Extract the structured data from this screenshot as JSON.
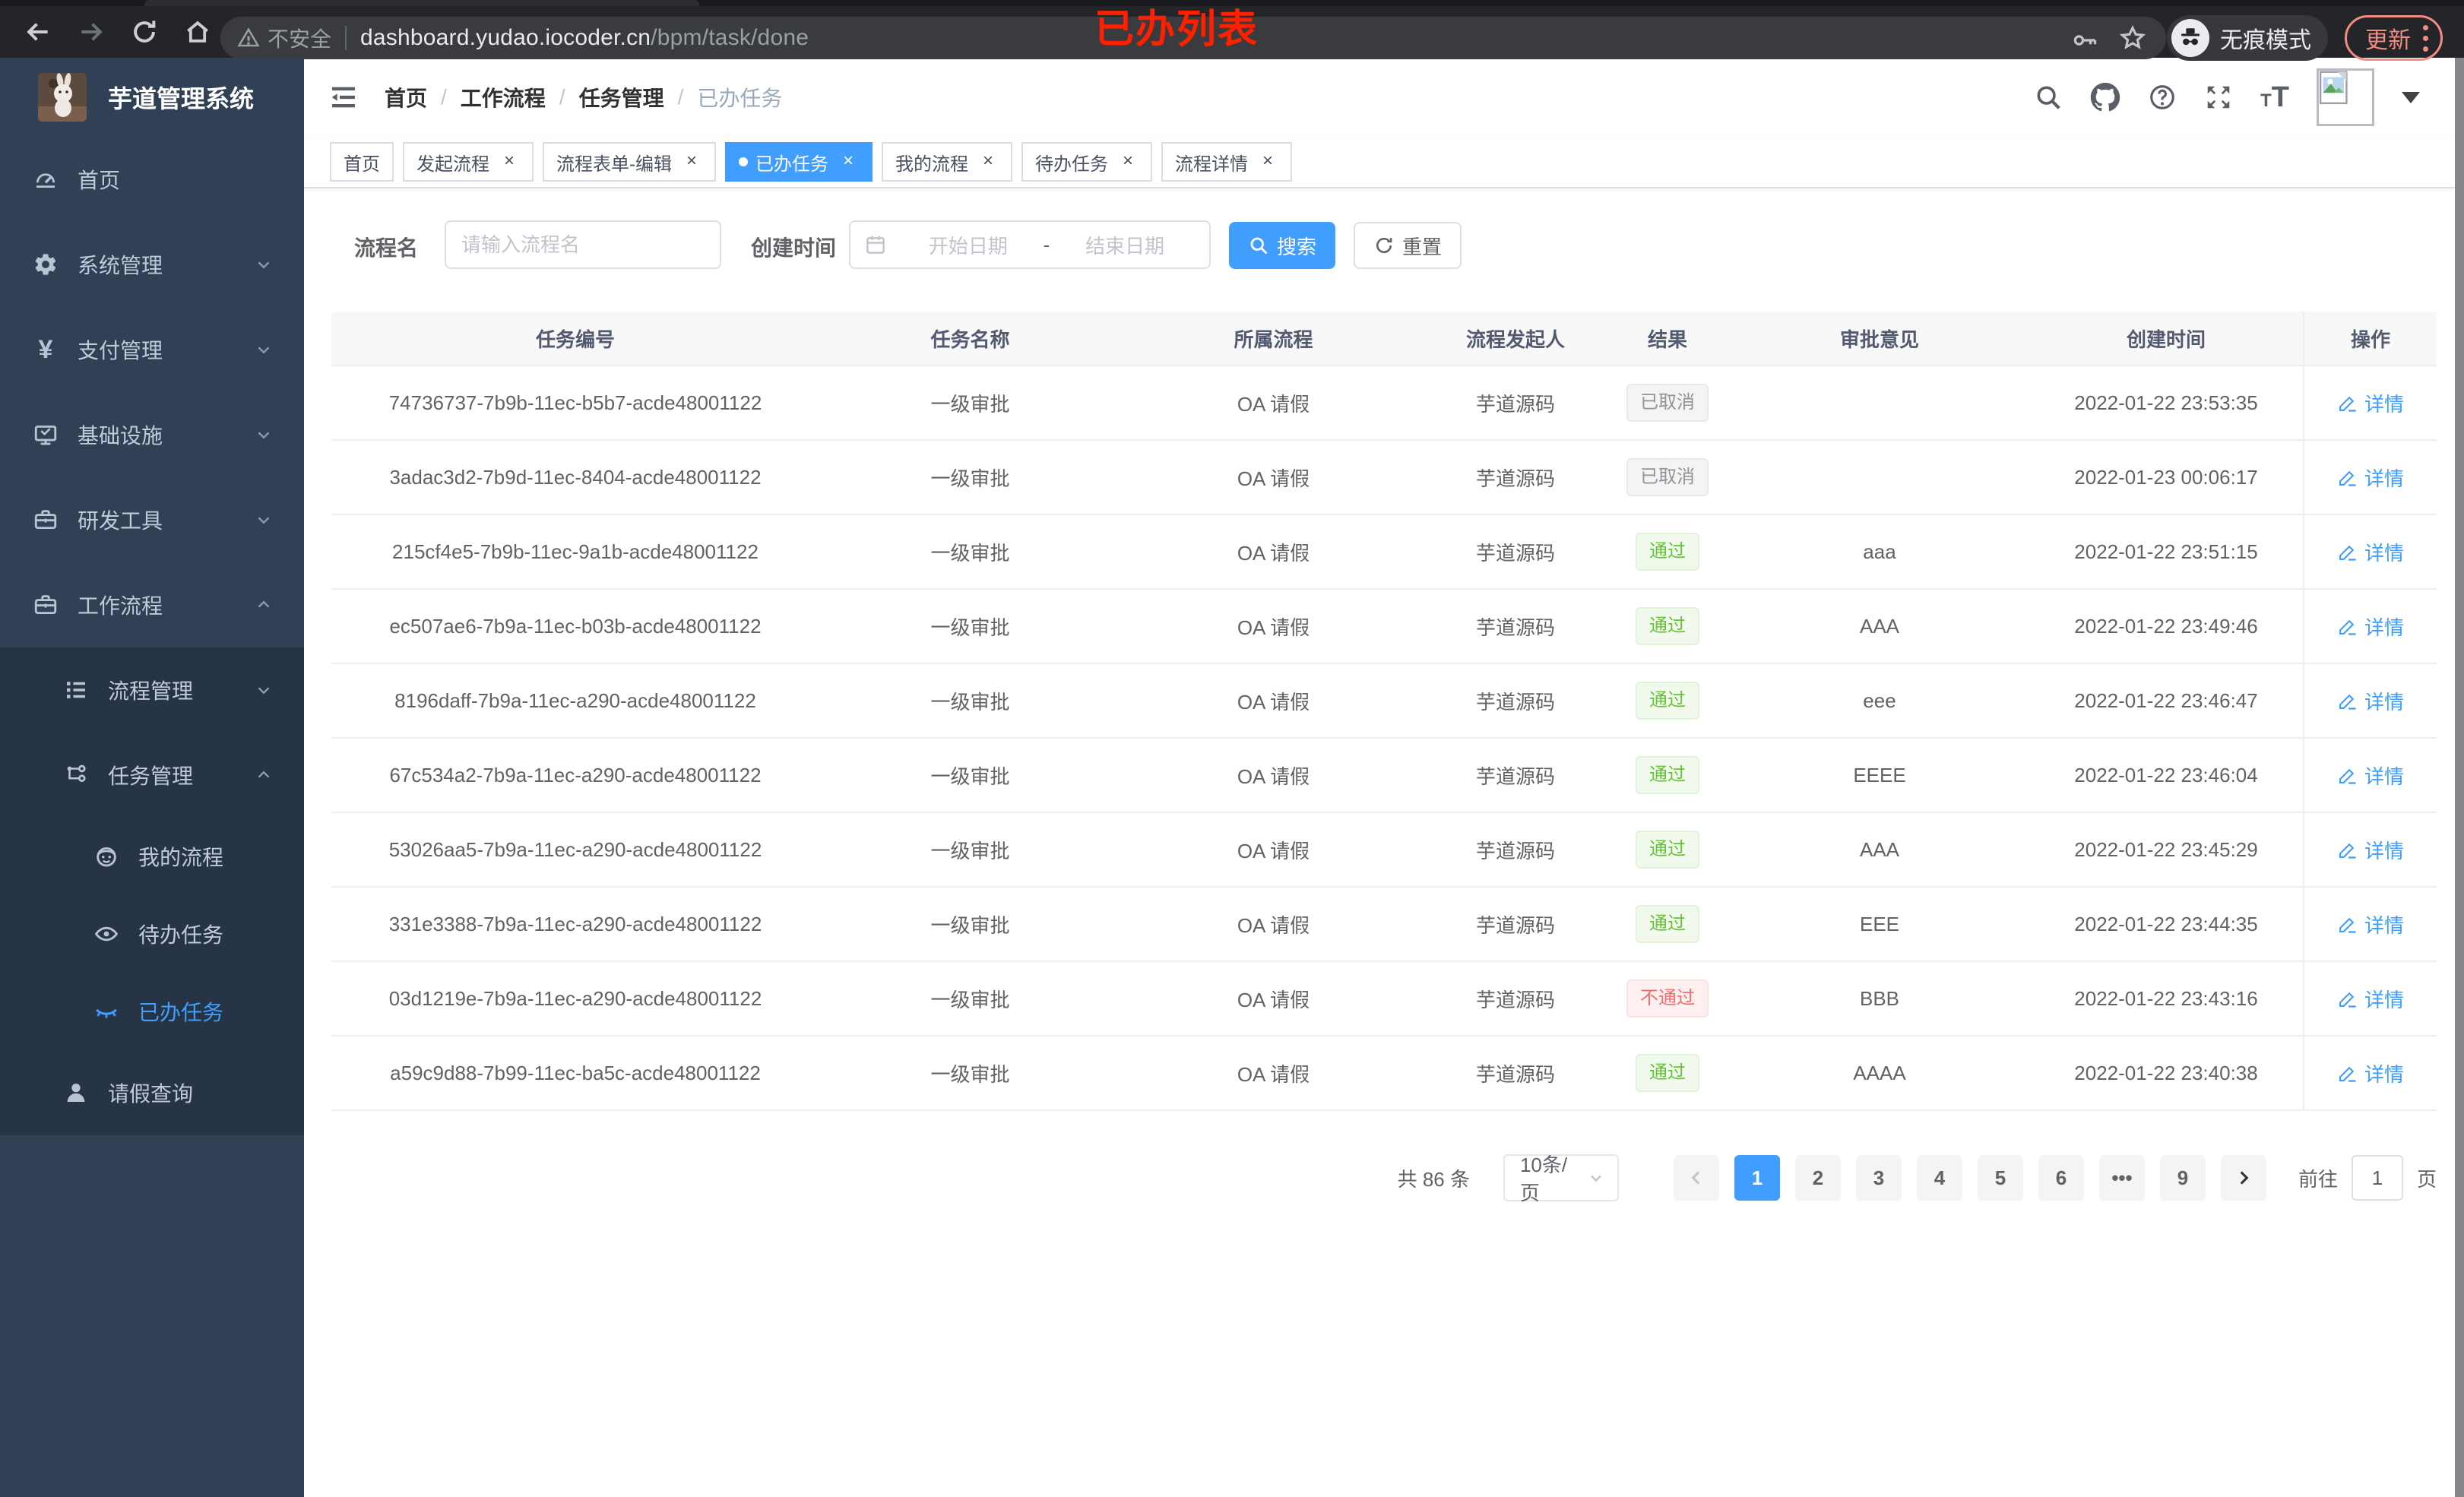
{
  "browser": {
    "security_label": "不安全",
    "url_host": "dashboard.yudao.iocoder.cn",
    "url_path": "/bpm/task/done",
    "incognito_label": "无痕模式",
    "update_label": "更新",
    "annotation": "已办列表",
    "nav_buttons": [
      "back-icon",
      "forward-icon",
      "reload-icon",
      "home-icon"
    ]
  },
  "colors": {
    "accent": "#409eff",
    "success": "#67c23a",
    "danger": "#f56c6c",
    "info": "#909399",
    "update_pill": "#f28b82",
    "annotation_red": "#ff2000",
    "sidebar_bg": "#304156",
    "submenu_bg": "#263445"
  },
  "sidebar": {
    "app_title": "芋道管理系统",
    "items": [
      {
        "label": "首页",
        "icon": "dashboard-icon",
        "level": 1,
        "chevron": "",
        "sub": false,
        "active": false
      },
      {
        "label": "系统管理",
        "icon": "gear-icon",
        "level": 1,
        "chevron": "down",
        "sub": false,
        "active": false
      },
      {
        "label": "支付管理",
        "icon": "yen-icon",
        "level": 1,
        "chevron": "down",
        "sub": false,
        "active": false
      },
      {
        "label": "基础设施",
        "icon": "monitor-icon",
        "level": 1,
        "chevron": "down",
        "sub": false,
        "active": false
      },
      {
        "label": "研发工具",
        "icon": "toolbox-icon",
        "level": 1,
        "chevron": "down",
        "sub": false,
        "active": false
      },
      {
        "label": "工作流程",
        "icon": "toolbox-icon",
        "level": 1,
        "chevron": "up",
        "sub": false,
        "active": false
      },
      {
        "label": "流程管理",
        "icon": "tree-list-icon",
        "level": 2,
        "chevron": "down",
        "sub": true,
        "active": false
      },
      {
        "label": "任务管理",
        "icon": "share-nodes-icon",
        "level": 2,
        "chevron": "up",
        "sub": true,
        "active": false
      },
      {
        "label": "我的流程",
        "icon": "face-icon",
        "level": 3,
        "chevron": "",
        "sub": true,
        "active": false
      },
      {
        "label": "待办任务",
        "icon": "eye-open-icon",
        "level": 3,
        "chevron": "",
        "sub": true,
        "active": false
      },
      {
        "label": "已办任务",
        "icon": "eye-closed-icon",
        "level": 3,
        "chevron": "",
        "sub": true,
        "active": true
      },
      {
        "label": "请假查询",
        "icon": "user-icon",
        "level": 2,
        "chevron": "",
        "sub": true,
        "active": false
      }
    ]
  },
  "header": {
    "breadcrumb": [
      "首页",
      "工作流程",
      "任务管理",
      "已办任务"
    ],
    "right_icons": [
      "search-icon",
      "github-icon",
      "help-icon",
      "fullscreen-icon",
      "font-size-icon"
    ]
  },
  "tabs": [
    {
      "label": "首页",
      "active": false,
      "closable": false
    },
    {
      "label": "发起流程",
      "active": false,
      "closable": true
    },
    {
      "label": "流程表单-编辑",
      "active": false,
      "closable": true
    },
    {
      "label": "已办任务",
      "active": true,
      "closable": true
    },
    {
      "label": "我的流程",
      "active": false,
      "closable": true
    },
    {
      "label": "待办任务",
      "active": false,
      "closable": true
    },
    {
      "label": "流程详情",
      "active": false,
      "closable": true
    }
  ],
  "filters": {
    "process_name_label": "流程名",
    "process_name_placeholder": "请输入流程名",
    "create_time_label": "创建时间",
    "start_placeholder": "开始日期",
    "range_separator": "-",
    "end_placeholder": "结束日期",
    "search_label": "搜索",
    "reset_label": "重置"
  },
  "table": {
    "columns": [
      "任务编号",
      "任务名称",
      "所属流程",
      "流程发起人",
      "结果",
      "审批意见",
      "创建时间",
      "操作"
    ],
    "detail_label": "详情",
    "rows": [
      {
        "id": "74736737-7b9b-11ec-b5b7-acde48001122",
        "name": "一级审批",
        "process": "OA 请假",
        "starter": "芋道源码",
        "result": "已取消",
        "result_type": "info",
        "comment": "",
        "created": "2022-01-22 23:53:35"
      },
      {
        "id": "3adac3d2-7b9d-11ec-8404-acde48001122",
        "name": "一级审批",
        "process": "OA 请假",
        "starter": "芋道源码",
        "result": "已取消",
        "result_type": "info",
        "comment": "",
        "created": "2022-01-23 00:06:17"
      },
      {
        "id": "215cf4e5-7b9b-11ec-9a1b-acde48001122",
        "name": "一级审批",
        "process": "OA 请假",
        "starter": "芋道源码",
        "result": "通过",
        "result_type": "success",
        "comment": "aaa",
        "created": "2022-01-22 23:51:15"
      },
      {
        "id": "ec507ae6-7b9a-11ec-b03b-acde48001122",
        "name": "一级审批",
        "process": "OA 请假",
        "starter": "芋道源码",
        "result": "通过",
        "result_type": "success",
        "comment": "AAA",
        "created": "2022-01-22 23:49:46"
      },
      {
        "id": "8196daff-7b9a-11ec-a290-acde48001122",
        "name": "一级审批",
        "process": "OA 请假",
        "starter": "芋道源码",
        "result": "通过",
        "result_type": "success",
        "comment": "eee",
        "created": "2022-01-22 23:46:47"
      },
      {
        "id": "67c534a2-7b9a-11ec-a290-acde48001122",
        "name": "一级审批",
        "process": "OA 请假",
        "starter": "芋道源码",
        "result": "通过",
        "result_type": "success",
        "comment": "EEEE",
        "created": "2022-01-22 23:46:04"
      },
      {
        "id": "53026aa5-7b9a-11ec-a290-acde48001122",
        "name": "一级审批",
        "process": "OA 请假",
        "starter": "芋道源码",
        "result": "通过",
        "result_type": "success",
        "comment": "AAA",
        "created": "2022-01-22 23:45:29"
      },
      {
        "id": "331e3388-7b9a-11ec-a290-acde48001122",
        "name": "一级审批",
        "process": "OA 请假",
        "starter": "芋道源码",
        "result": "通过",
        "result_type": "success",
        "comment": "EEE",
        "created": "2022-01-22 23:44:35"
      },
      {
        "id": "03d1219e-7b9a-11ec-a290-acde48001122",
        "name": "一级审批",
        "process": "OA 请假",
        "starter": "芋道源码",
        "result": "不通过",
        "result_type": "danger",
        "comment": "BBB",
        "created": "2022-01-22 23:43:16"
      },
      {
        "id": "a59c9d88-7b99-11ec-ba5c-acde48001122",
        "name": "一级审批",
        "process": "OA 请假",
        "starter": "芋道源码",
        "result": "通过",
        "result_type": "success",
        "comment": "AAAA",
        "created": "2022-01-22 23:40:38"
      }
    ]
  },
  "pagination": {
    "total_label": "共 86 条",
    "page_size": "10条/页",
    "pages": [
      "1",
      "2",
      "3",
      "4",
      "5",
      "6",
      "•••",
      "9"
    ],
    "active_page": "1",
    "goto_label": "前往",
    "goto_value": "1",
    "page_unit": "页"
  }
}
